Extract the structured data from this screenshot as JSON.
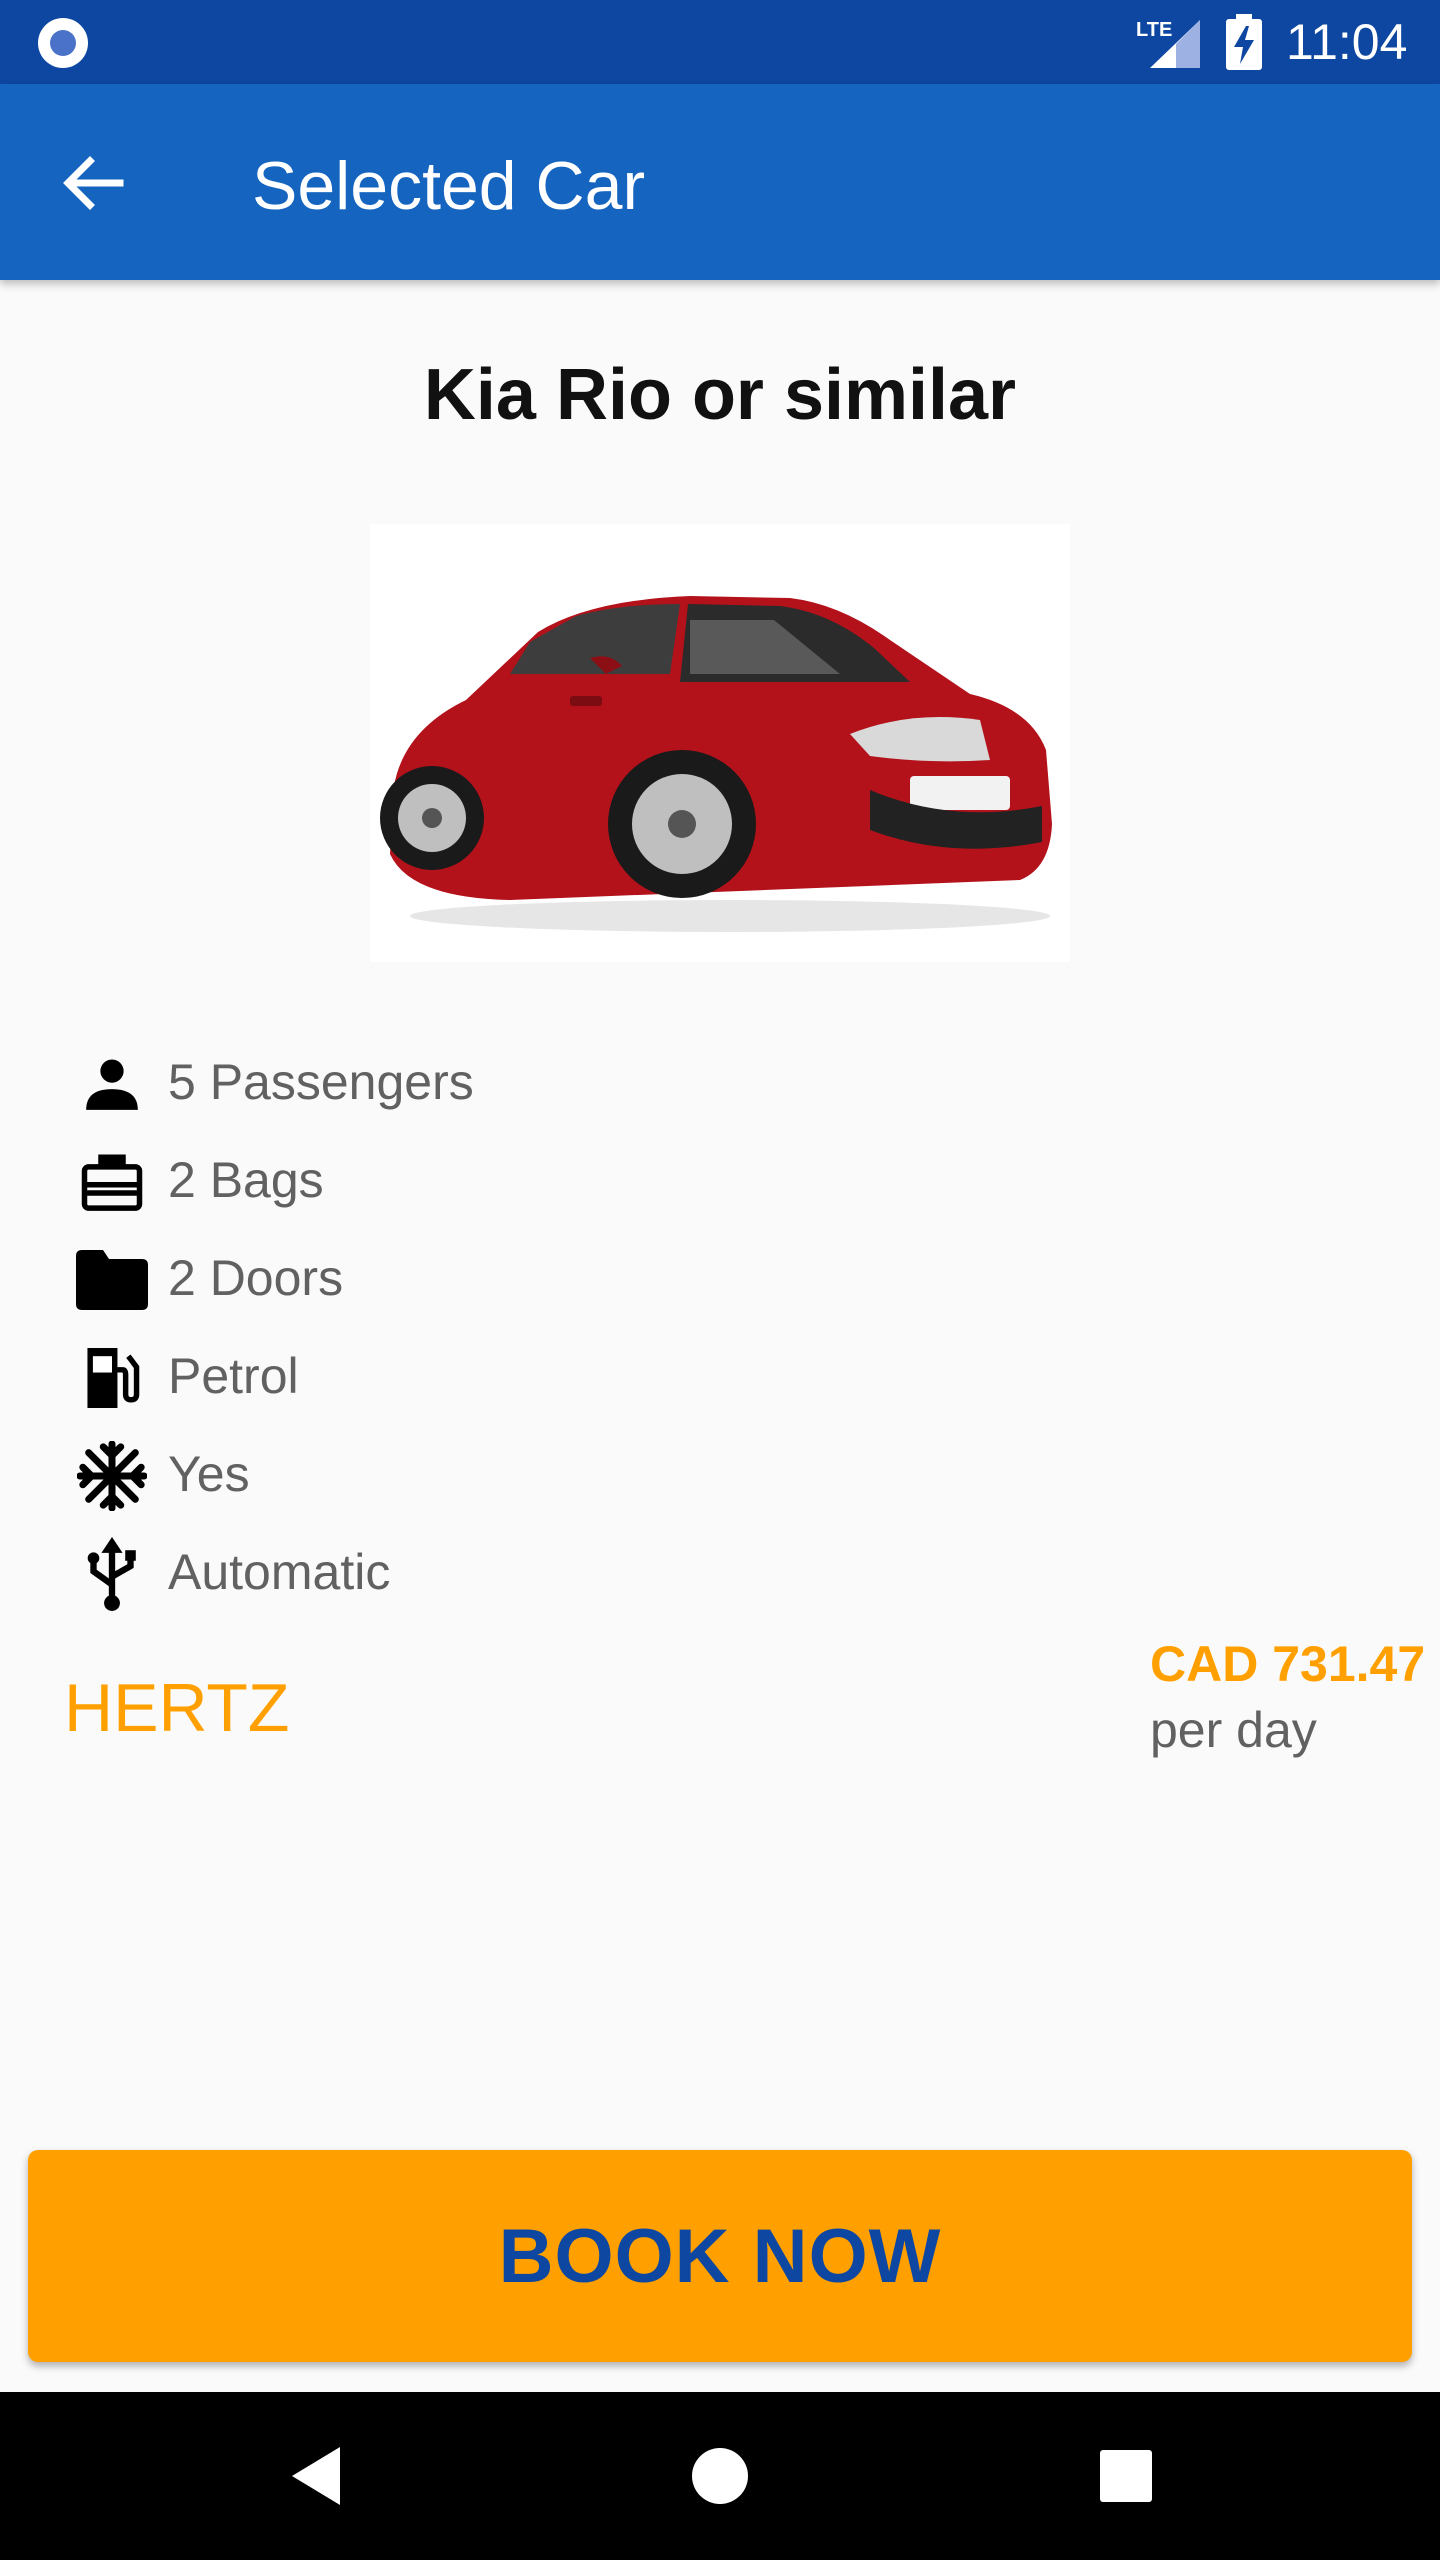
{
  "status_bar": {
    "network": "LTE",
    "time": "11:04"
  },
  "app_bar": {
    "title": "Selected Car",
    "back_icon": "arrow-back-icon"
  },
  "car": {
    "name": "Kia Rio or similar",
    "image": "red Kia Rio hatchback photo"
  },
  "features": [
    {
      "icon": "person-icon",
      "label": "5 Passengers"
    },
    {
      "icon": "briefcase-icon",
      "label": "2 Bags"
    },
    {
      "icon": "folder-icon",
      "label": "2 Doors"
    },
    {
      "icon": "fuel-pump-icon",
      "label": "Petrol"
    },
    {
      "icon": "snowflake-icon",
      "label": "Yes"
    },
    {
      "icon": "usb-icon",
      "label": "Automatic"
    }
  ],
  "vendor": "HERTZ",
  "pricing": {
    "price": "CAD 731.47",
    "period": "per day"
  },
  "book_button": {
    "label": "BOOK NOW"
  },
  "colors": {
    "status_bar": "#0d47a1",
    "app_bar": "#1565c0",
    "accent": "#ffa000",
    "button_text": "#0d47a1"
  }
}
